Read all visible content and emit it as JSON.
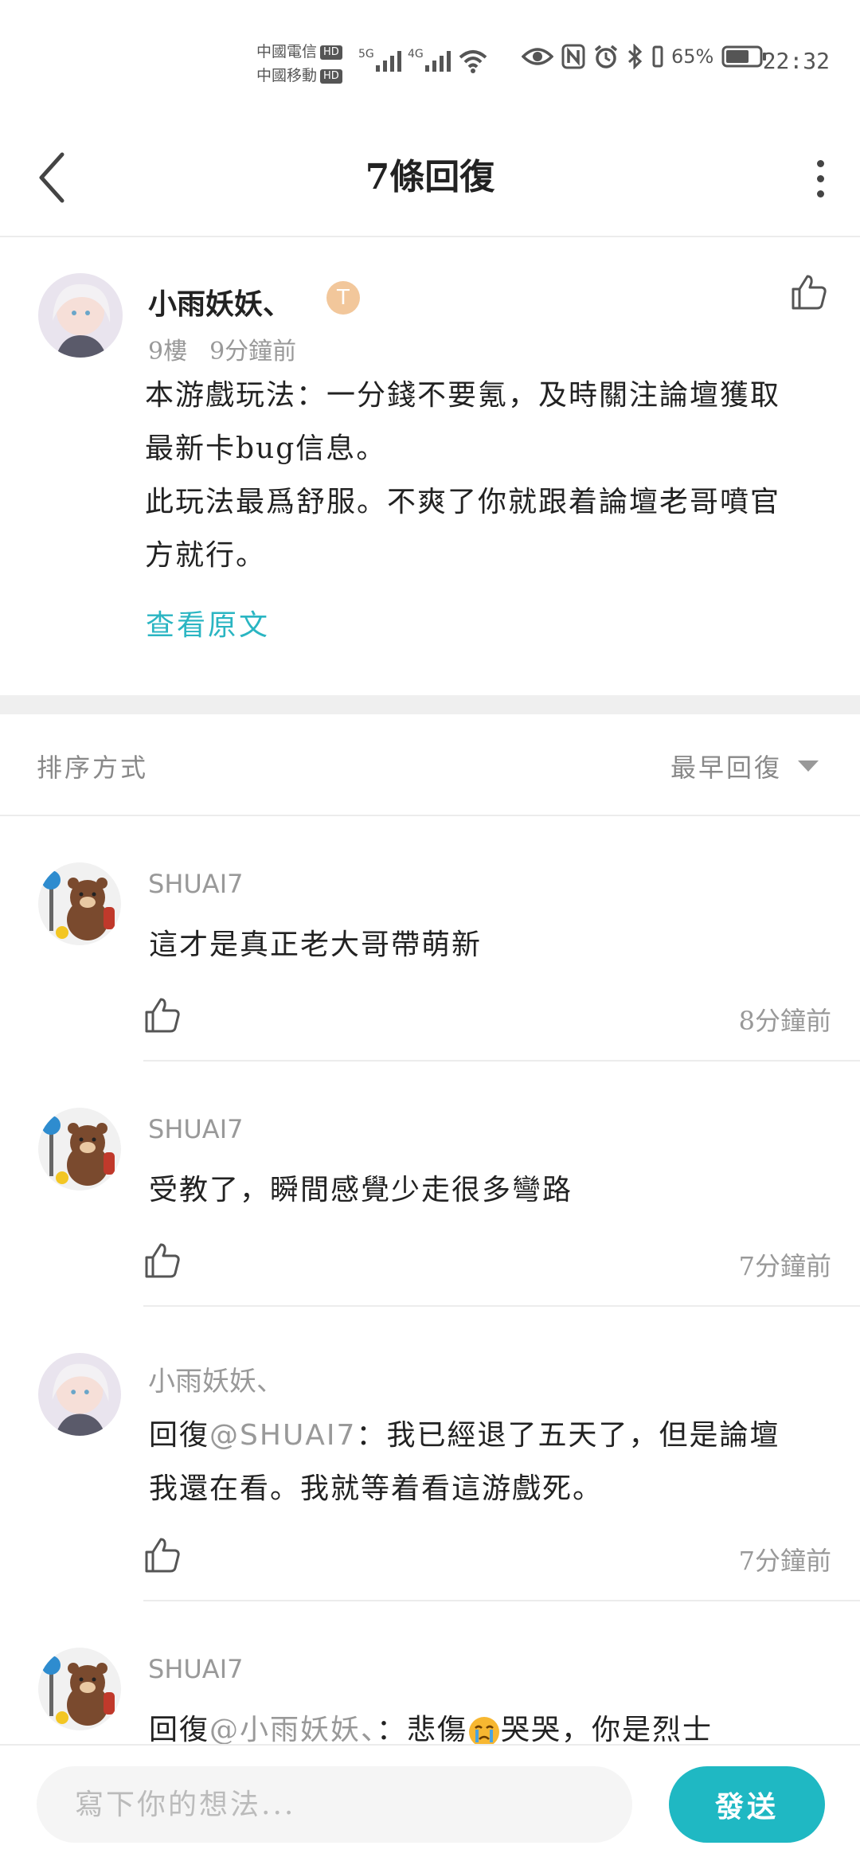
{
  "status_bar": {
    "carrier1": "中國電信",
    "carrier2": "中國移動",
    "hd": "HD",
    "net1": "5G",
    "net2": "4G",
    "battery": "65%",
    "time": "22:32"
  },
  "header": {
    "title": "7條回復"
  },
  "post": {
    "username": "小雨妖妖、",
    "badge": "T",
    "floor": "9樓",
    "time": "9分鐘前",
    "body_line1": "本游戲玩法：一分錢不要氪，及時關注論壇獲取最新卡bug信息。",
    "body_line2": "此玩法最爲舒服。不爽了你就跟着論壇老哥噴官方就行。",
    "view_original": "查看原文"
  },
  "sort": {
    "label": "排序方式",
    "value": "最早回復"
  },
  "replies": [
    {
      "user": "SHUAI7",
      "text": "這才是真正老大哥帶萌新",
      "time": "8分鐘前"
    },
    {
      "user": "SHUAI7",
      "text": "受教了，瞬間感覺少走很多彎路",
      "time": "7分鐘前"
    },
    {
      "user": "小雨妖妖、",
      "prefix": "回復",
      "mention": "@SHUAI7",
      "text": "：我已經退了五天了，但是論壇我還在看。我就等着看這游戲死。",
      "time": "7分鐘前"
    },
    {
      "user": "SHUAI7",
      "prefix": "回復",
      "mention": "@小雨妖妖、",
      "text": "：悲傷",
      "text2": "哭哭，你是烈士"
    }
  ],
  "compose": {
    "placeholder": "寫下你的想法...",
    "send_label": "發送"
  },
  "colors": {
    "accent": "#1fb8c3",
    "link": "#2ab5c2",
    "muted": "#999999"
  }
}
